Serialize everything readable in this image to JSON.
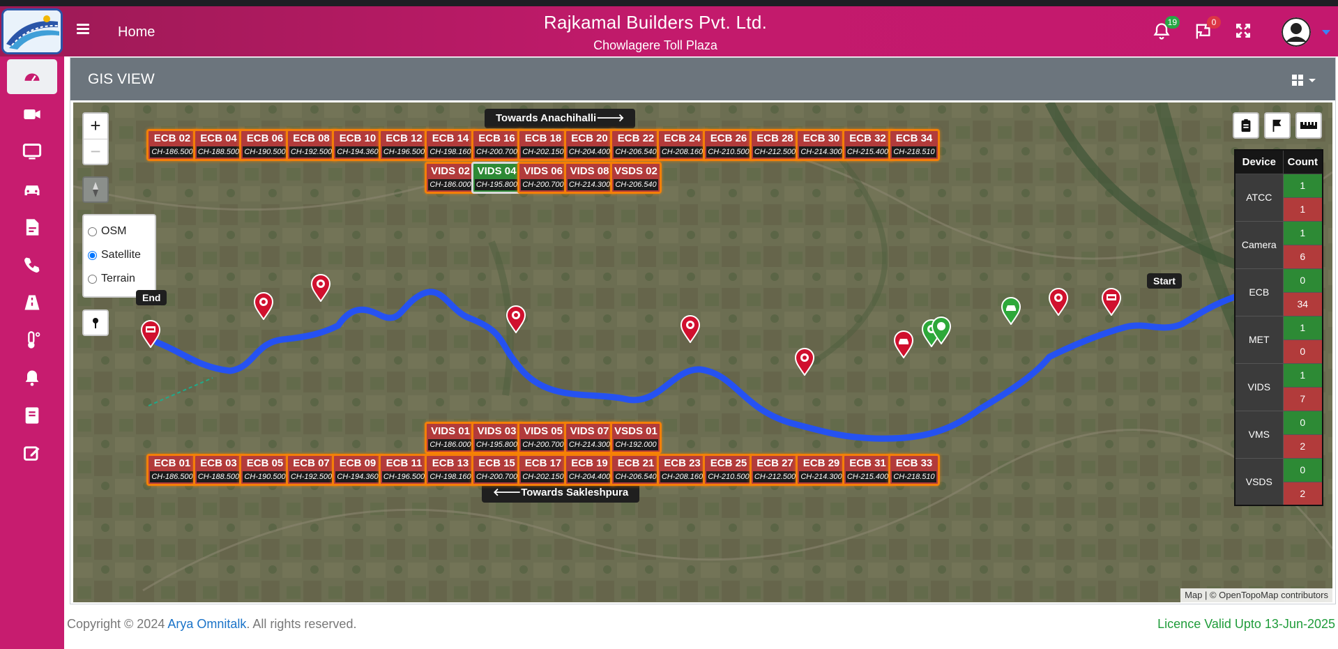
{
  "header": {
    "menu_label": "Home",
    "company": "Rajkamal Builders Pvt. Ltd.",
    "plaza": "Chowlagere Toll Plaza",
    "notifications_count": "19",
    "flags_count": "0",
    "notifications_badge_color": "#28a745",
    "flags_badge_color": "#dc3545"
  },
  "sidebar": {
    "items": [
      {
        "icon": "dashboard-icon",
        "active": true
      },
      {
        "icon": "video-camera-icon"
      },
      {
        "icon": "monitor-icon"
      },
      {
        "icon": "car-icon"
      },
      {
        "icon": "report-file-icon"
      },
      {
        "icon": "phone-icon"
      },
      {
        "icon": "road-icon"
      },
      {
        "icon": "thermometer-icon"
      },
      {
        "icon": "bell-icon"
      },
      {
        "icon": "book-icon"
      },
      {
        "icon": "edit-icon"
      }
    ]
  },
  "panel": {
    "title": "GIS VIEW"
  },
  "map": {
    "zoom_in": "+",
    "zoom_out": "−",
    "layers": [
      "OSM",
      "Satellite",
      "Terrain"
    ],
    "selected_layer": "Satellite",
    "towards_top": "Towards Anachihalli🡒",
    "towards_bottom": "🡐Towards Sakleshpura",
    "label_start": "Start",
    "label_end": "End",
    "attribution": "Map | © OpenTopoMap contributors",
    "top_ecb": [
      {
        "name": "ECB 02",
        "ch": "CH-186.500"
      },
      {
        "name": "ECB 04",
        "ch": "CH-188.500"
      },
      {
        "name": "ECB 06",
        "ch": "CH-190.500"
      },
      {
        "name": "ECB 08",
        "ch": "CH-192.500"
      },
      {
        "name": "ECB 10",
        "ch": "CH-194.360"
      },
      {
        "name": "ECB 12",
        "ch": "CH-196.500"
      },
      {
        "name": "ECB 14",
        "ch": "CH-198.160"
      },
      {
        "name": "ECB 16",
        "ch": "CH-200.700"
      },
      {
        "name": "ECB 18",
        "ch": "CH-202.150"
      },
      {
        "name": "ECB 20",
        "ch": "CH-204.400"
      },
      {
        "name": "ECB 22",
        "ch": "CH-206.540"
      },
      {
        "name": "ECB 24",
        "ch": "CH-208.160"
      },
      {
        "name": "ECB 26",
        "ch": "CH-210.500"
      },
      {
        "name": "ECB 28",
        "ch": "CH-212.500"
      },
      {
        "name": "ECB 30",
        "ch": "CH-214.300"
      },
      {
        "name": "ECB 32",
        "ch": "CH-215.400"
      },
      {
        "name": "ECB 34",
        "ch": "CH-218.510"
      }
    ],
    "top_vids": [
      {
        "name": "VIDS 02",
        "ch": "CH-186.000",
        "status": "down"
      },
      {
        "name": "VIDS 04",
        "ch": "CH-195.800",
        "status": "up"
      },
      {
        "name": "VIDS 06",
        "ch": "CH-200.700",
        "status": "down"
      },
      {
        "name": "VIDS 08",
        "ch": "CH-214.300",
        "status": "down"
      },
      {
        "name": "VSDS 02",
        "ch": "CH-206.540",
        "status": "down"
      }
    ],
    "bottom_vids": [
      {
        "name": "VIDS 01",
        "ch": "CH-186.000"
      },
      {
        "name": "VIDS 03",
        "ch": "CH-195.800"
      },
      {
        "name": "VIDS 05",
        "ch": "CH-200.700"
      },
      {
        "name": "VIDS 07",
        "ch": "CH-214.300"
      },
      {
        "name": "VSDS 01",
        "ch": "CH-192.000"
      }
    ],
    "bottom_ecb": [
      {
        "name": "ECB 01",
        "ch": "CH-186.500"
      },
      {
        "name": "ECB 03",
        "ch": "CH-188.500"
      },
      {
        "name": "ECB 05",
        "ch": "CH-190.500"
      },
      {
        "name": "ECB 07",
        "ch": "CH-192.500"
      },
      {
        "name": "ECB 09",
        "ch": "CH-194.360"
      },
      {
        "name": "ECB 11",
        "ch": "CH-196.500"
      },
      {
        "name": "ECB 13",
        "ch": "CH-198.160"
      },
      {
        "name": "ECB 15",
        "ch": "CH-200.700"
      },
      {
        "name": "ECB 17",
        "ch": "CH-202.150"
      },
      {
        "name": "ECB 19",
        "ch": "CH-204.400"
      },
      {
        "name": "ECB 21",
        "ch": "CH-206.540"
      },
      {
        "name": "ECB 23",
        "ch": "CH-208.160"
      },
      {
        "name": "ECB 25",
        "ch": "CH-210.500"
      },
      {
        "name": "ECB 27",
        "ch": "CH-212.500"
      },
      {
        "name": "ECB 29",
        "ch": "CH-214.300"
      },
      {
        "name": "ECB 31",
        "ch": "CH-215.400"
      },
      {
        "name": "ECB 33",
        "ch": "CH-218.510"
      }
    ]
  },
  "device_table": {
    "headers": [
      "Device",
      "Count"
    ],
    "rows": [
      {
        "device": "ATCC",
        "up": "1",
        "down": "1"
      },
      {
        "device": "Camera",
        "up": "1",
        "down": "6"
      },
      {
        "device": "ECB",
        "up": "0",
        "down": "34"
      },
      {
        "device": "MET",
        "up": "1",
        "down": "0"
      },
      {
        "device": "VIDS",
        "up": "1",
        "down": "7"
      },
      {
        "device": "VMS",
        "up": "0",
        "down": "2"
      },
      {
        "device": "VSDS",
        "up": "0",
        "down": "2"
      }
    ]
  },
  "footer": {
    "copyright_prefix": "Copyright © 2024 ",
    "company_link": "Arya Omnitalk",
    "copyright_suffix": ". All rights reserved.",
    "licence": "Licence Valid Upto 13-Jun-2025"
  },
  "colors": {
    "brand": "#c71c6f",
    "status_up": "#2d8a35",
    "status_down": "#b23b3b",
    "route": "#1f4fff"
  }
}
